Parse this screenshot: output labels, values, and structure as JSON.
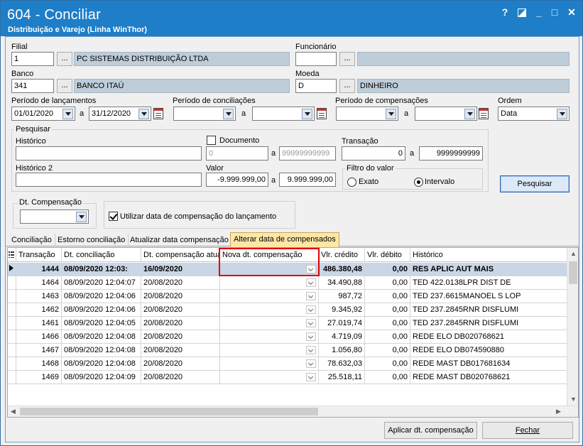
{
  "window": {
    "title": "604 - Conciliar",
    "subtitle": "Distribuição e Varejo (Linha WinThor)",
    "controls": {
      "help": "?",
      "minimize": "_",
      "maximize": "□",
      "close": "✕"
    }
  },
  "filial": {
    "label": "Filial",
    "code": "1",
    "browse": "...",
    "name": "PC SISTEMAS DISTRIBUIÇÃO LTDA"
  },
  "funcionario": {
    "label": "Funcionário",
    "code": "",
    "browse": "...",
    "name": ""
  },
  "banco": {
    "label": "Banco",
    "code": "341",
    "browse": "...",
    "name": "BANCO ITAÚ"
  },
  "moeda": {
    "label": "Moeda",
    "code": "D",
    "browse": "...",
    "name": "DINHEIRO"
  },
  "periodo_lancamentos": {
    "label": "Período de lançamentos",
    "from": "01/01/2020",
    "to": "31/12/2020",
    "sep": "a"
  },
  "periodo_conciliacoes": {
    "label": "Período de conciliações",
    "from": "",
    "to": "",
    "sep": "a"
  },
  "periodo_compensacoes": {
    "label": "Período de compensações",
    "from": "",
    "to": "",
    "sep": "a"
  },
  "ordem": {
    "label": "Ordem",
    "value": "Data"
  },
  "pesquisar_group": {
    "title": "Pesquisar",
    "historico_label": "Histórico",
    "historico_value": "",
    "historico2_label": "Histórico 2",
    "historico2_value": "",
    "documento_label": "Documento",
    "documento_from": "0",
    "documento_to": "99999999999",
    "transacao_label": "Transação",
    "transacao_from": "0",
    "transacao_to": "9999999999",
    "valor_label": "Valor",
    "valor_from": "-9.999.999,00",
    "valor_to": "9.999.999,00",
    "sep": "a",
    "filtro_label": "Filtro do valor",
    "filtro_exato": "Exato",
    "filtro_intervalo": "Intervalo",
    "filtro_selected": "Intervalo"
  },
  "pesquisar_button": "Pesquisar",
  "dt_compensacao": {
    "title": "Dt. Compensação",
    "value": ""
  },
  "utilizar_data": {
    "label": "Utilizar data de compensação do lançamento",
    "checked": true
  },
  "tabs": [
    {
      "label": "Conciliação",
      "active": false
    },
    {
      "label": "Estorno conciliação",
      "active": false
    },
    {
      "label": "Atualizar data compensação",
      "active": false
    },
    {
      "label": "Alterar data de compensados",
      "active": true
    }
  ],
  "grid": {
    "columns": [
      "Transação",
      "Dt. conciliação",
      "Dt. compensação atual",
      "Nova dt. compensação",
      "Vlr. crédito",
      "Vlr. débito",
      "Histórico"
    ],
    "rows": [
      [
        "1444",
        "08/09/2020 12:03:",
        "16/09/2020",
        "",
        "486.380,48",
        "0,00",
        "RES APLIC AUT MAIS"
      ],
      [
        "1464",
        "08/09/2020 12:04:07",
        "20/08/2020",
        "",
        "34.490,88",
        "0,00",
        "TED 422.0138LPR DIST DE"
      ],
      [
        "1463",
        "08/09/2020 12:04:06",
        "20/08/2020",
        "",
        "987,72",
        "0,00",
        "TED 237.6615MANOEL S LOP"
      ],
      [
        "1462",
        "08/09/2020 12:04:06",
        "20/08/2020",
        "",
        "9.345,92",
        "0,00",
        "TED 237.2845RNR DISFLUMI"
      ],
      [
        "1461",
        "08/09/2020 12:04:05",
        "20/08/2020",
        "",
        "27.019,74",
        "0,00",
        "TED 237.2845RNR DISFLUMI"
      ],
      [
        "1466",
        "08/09/2020 12:04:08",
        "20/08/2020",
        "",
        "4.719,09",
        "0,00",
        "REDE  ELO  DB020768621"
      ],
      [
        "1467",
        "08/09/2020 12:04:08",
        "20/08/2020",
        "",
        "1.056,80",
        "0,00",
        "REDE  ELO  DB074590880"
      ],
      [
        "1468",
        "08/09/2020 12:04:08",
        "20/08/2020",
        "",
        "78.632,03",
        "0,00",
        "REDE  MAST DB017681634"
      ],
      [
        "1469",
        "08/09/2020 12:04:09",
        "20/08/2020",
        "",
        "25.518,11",
        "0,00",
        "REDE  MAST DB020768621"
      ]
    ]
  },
  "footer": {
    "aplicar": "Aplicar dt. compensação",
    "fechar": "Fechar"
  }
}
